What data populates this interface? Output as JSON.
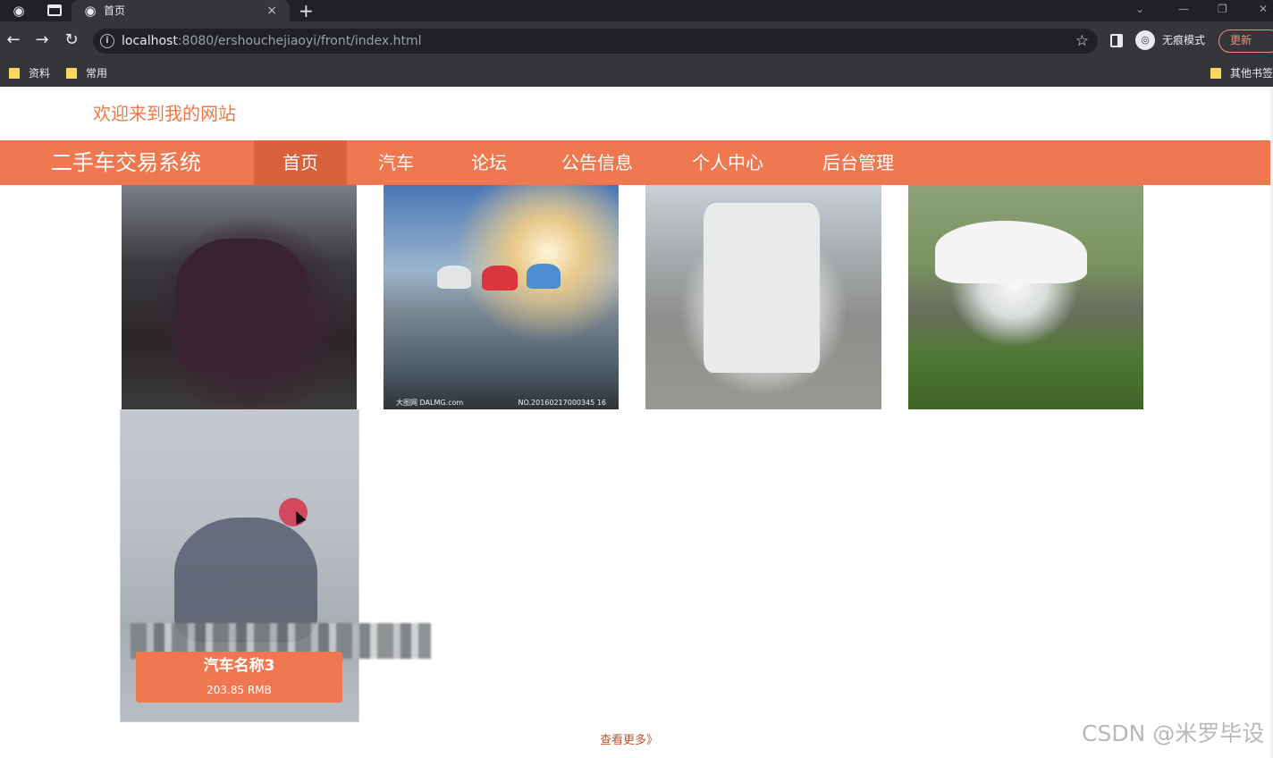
{
  "browser": {
    "tab_title": "首页",
    "tab_close": "×",
    "new_tab": "+",
    "url_host": "localhost",
    "url_rest": ":8080/ershouchejiaoyi/front/index.html",
    "incognito_label": "无痕模式",
    "update_label": "更新",
    "bookmarks": [
      {
        "label": "资料"
      },
      {
        "label": "常用"
      },
      {
        "label": "其他书签"
      }
    ]
  },
  "site": {
    "welcome": "欢迎来到我的网站",
    "brand": "二手车交易系统",
    "nav": [
      {
        "label": "首页",
        "active": true
      },
      {
        "label": "汽车",
        "active": false
      },
      {
        "label": "论坛",
        "active": false
      },
      {
        "label": "公告信息",
        "active": false
      },
      {
        "label": "个人中心",
        "active": false
      },
      {
        "label": "后台管理",
        "active": false
      }
    ]
  },
  "cars": {
    "image_captions": {
      "left": "大图网 DALMG.com",
      "right": "NO.20160217000345 16"
    },
    "hover_card": {
      "name": "汽车名称3",
      "price": "203.85 RMB"
    }
  },
  "more_link": "查看更多》",
  "watermark": "CSDN @米罗毕设"
}
